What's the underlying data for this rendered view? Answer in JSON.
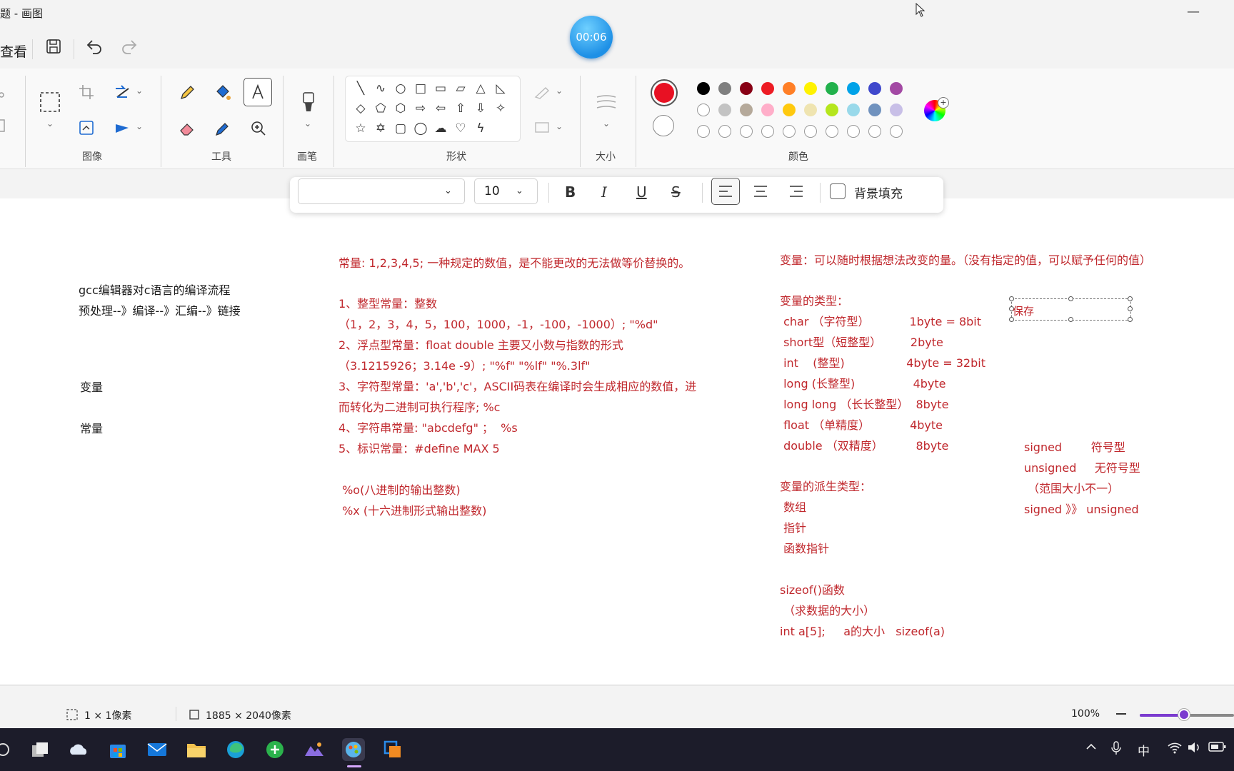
{
  "window": {
    "title": "题 - 画图",
    "minimize_glyph": "—"
  },
  "timer": {
    "value": "00:06"
  },
  "quick_toolbar": {
    "view_menu": "查看",
    "save_icon": "save-icon",
    "undo_icon": "undo-icon",
    "redo_icon": "redo-icon"
  },
  "ribbon": {
    "groups": {
      "image": "图像",
      "tools": "工具",
      "brushes": "画笔",
      "shapes": "形状",
      "size": "大小",
      "colors": "颜色"
    },
    "current_color": "#e81123",
    "palette_row1": [
      "#000000",
      "#7f7f7f",
      "#880015",
      "#ed1c24",
      "#ff7f27",
      "#fff200",
      "#22b14c",
      "#00a2e8",
      "#3f48cc",
      "#a349a4"
    ],
    "palette_row2": [
      "#ffffff",
      "#c3c3c3",
      "#b5a99a",
      "#ffaec9",
      "#ffc90e",
      "#efe4b0",
      "#b5e61d",
      "#99d9ea",
      "#7092be",
      "#c8bfe7"
    ]
  },
  "text_toolbar": {
    "font_name": "",
    "font_size": "10",
    "bold": "B",
    "italic": "I",
    "underline": "U",
    "strike": "S",
    "background_fill": "背景填充"
  },
  "canvas": {
    "left_black": [
      "gcc编辑器对c语言的编译流程",
      "预处理--》编译--》汇编--》链接",
      "变量",
      "常量"
    ],
    "middle_red": [
      "常量: 1,2,3,4,5; 一种规定的数值，是不能更改的无法做等价替换的。",
      "1、整型常量：整数",
      "（1，2，3，4，5，100，1000，-1，-100，-1000）; \"%d\"",
      "2、浮点型常量：float double 主要又小数与指数的形式",
      "（3.1215926；3.14e -9）; \"%f\" \"%lf\" \"%.3lf\"",
      "3、字符型常量：'a','b','c'，ASCII码表在编译时会生成相应的数值，进",
      "而转化为二进制可执行程序; %c",
      "4、字符串常量: \"abcdefg\" ；  %s",
      "5、标识常量：#define MAX 5",
      " %o(八进制的输出整数)",
      " %x (十六进制形式输出整数)"
    ],
    "right_red": [
      "变量：可以随时根据想法改变的量。（没有指定的值，可以赋予任何的值）",
      "变量的类型：",
      " char （字符型）           1byte = 8bit",
      " short型（短整型）        2byte",
      " int    (整型)                 4byte = 32bit",
      " long (长整型)                4byte",
      " long long （长长整型）  8byte",
      " float （单精度）           4byte",
      " double （双精度）         8byte",
      "变量的派生类型：",
      " 数组",
      " 指针",
      " 函数指针",
      "sizeof()函数",
      " （求数据的大小）",
      "int a[5];     a的大小   sizeof(a)"
    ],
    "far_right_red": [
      "signed        符号型",
      "unsigned     无符号型",
      " （范围大小不一）",
      "signed 》》 unsigned"
    ],
    "text_box": "保存"
  },
  "status": {
    "selection": "1 × 1像素",
    "canvas_size": "1885 × 2040像素",
    "zoom": "100%",
    "zoom_level_fraction": 0.47
  },
  "taskbar": {
    "ime": "中"
  }
}
